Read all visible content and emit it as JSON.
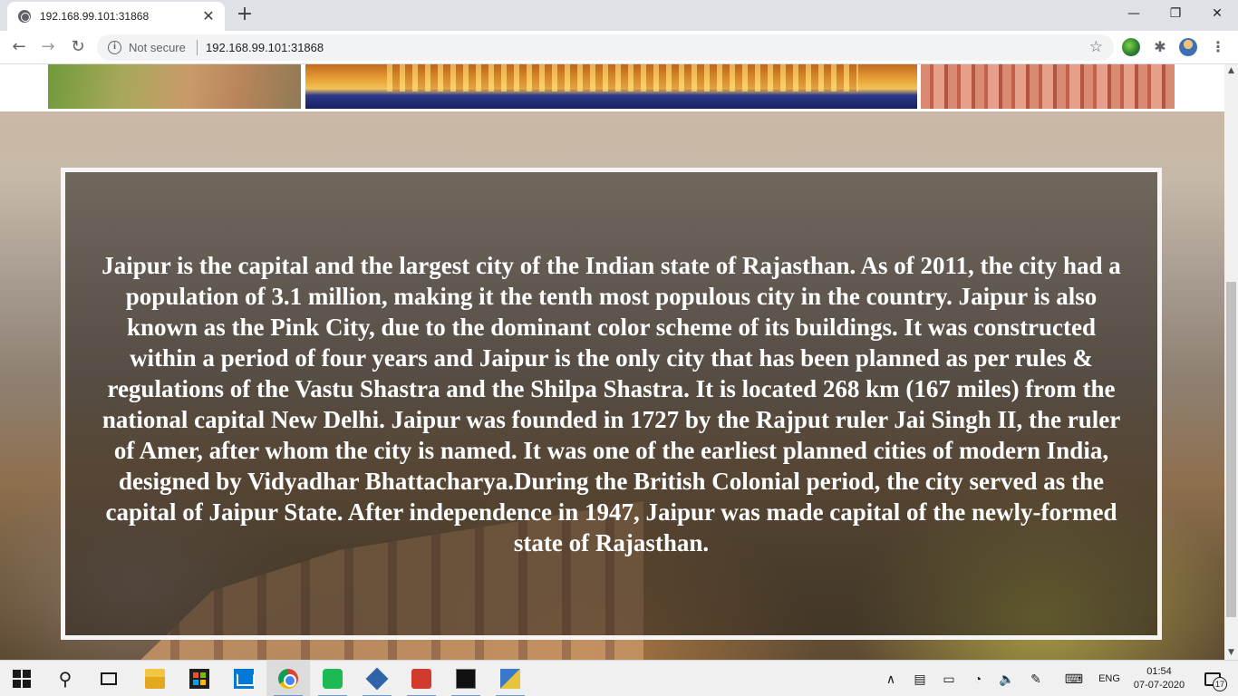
{
  "browser": {
    "tab_title": "192.168.99.101:31868",
    "new_tab_symbol": "+",
    "omnibox": {
      "security_label": "Not secure",
      "url": "192.168.99.101:31868"
    }
  },
  "page": {
    "description": "Jaipur is the capital and the largest city of the Indian state of Rajasthan. As of 2011, the city had a population of 3.1 million, making it the tenth most populous city in the country. Jaipur is also known as the Pink City, due to the dominant color scheme of its buildings. It was constructed within a period of four years and Jaipur is the only city that has been planned as per rules & regulations of the Vastu Shastra and the Shilpa Shastra. It is located 268 km (167 miles) from the national capital New Delhi. Jaipur was founded in 1727 by the Rajput ruler Jai Singh II, the ruler of Amer, after whom the city is named. It was one of the earliest planned cities of modern India, designed by Vidyadhar Bhattacharya.During the British Colonial period, the city served as the capital of Jaipur State. After independence in 1947, Jaipur was made capital of the newly-formed state of Rajasthan."
  },
  "taskbar": {
    "apps": [
      "file-explorer",
      "microsoft-store",
      "mail",
      "chrome",
      "spotify",
      "virtualbox",
      "red-app",
      "terminal",
      "network-app"
    ],
    "tray": {
      "language": "ENG",
      "time": "01:54",
      "date": "07-07-2020",
      "notification_count": "17"
    }
  }
}
